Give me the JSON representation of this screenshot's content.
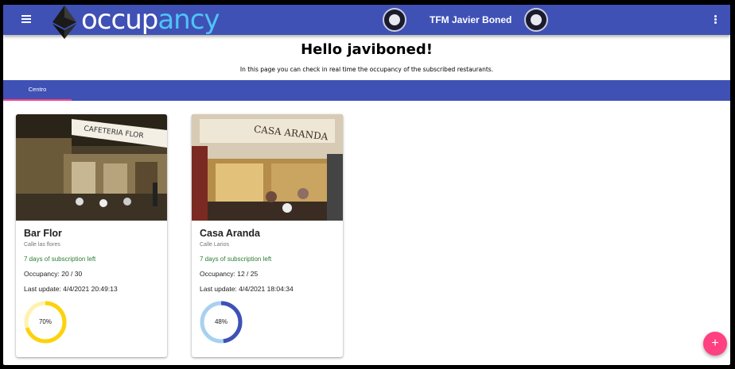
{
  "header": {
    "logo_text": [
      "occup",
      "ancy"
    ],
    "title": "TFM Javier Boned",
    "menu_icon": "menu-icon",
    "more_icon": "more-vert-icon",
    "colors": {
      "primary": "#3f51b5",
      "logo_accent": "#4fc3f7"
    }
  },
  "main": {
    "greeting": "Hello javiboned!",
    "intro": "In this page you can check in real time the occupancy of the subscribed restaurants."
  },
  "tabs": [
    {
      "label": "Centro",
      "selected": true
    }
  ],
  "restaurants": [
    {
      "name": "Bar Flor",
      "street": "Calle las flores",
      "subscription": "7 days of subscription left",
      "occupancy": "Occupancy: 20 / 30",
      "last_update": "Last update: 4/4/2021 20:49:13",
      "percent_label": "70%",
      "percent": 70,
      "gauge_color": "#fdd20c",
      "gauge_track": "#fff2b0",
      "photo_sign": "CAFETERIA FLOR"
    },
    {
      "name": "Casa Aranda",
      "street": "Calle Larios",
      "subscription": "7 days of subscription left",
      "occupancy": "Occupancy: 12 / 25",
      "last_update": "Last update: 4/4/2021 18:04:34",
      "percent_label": "48%",
      "percent": 48,
      "gauge_color": "#3f51b5",
      "gauge_track": "#a8d1f0",
      "photo_sign": "CASA ARANDA"
    }
  ],
  "fab": {
    "label": "+",
    "color": "#ff4081"
  }
}
